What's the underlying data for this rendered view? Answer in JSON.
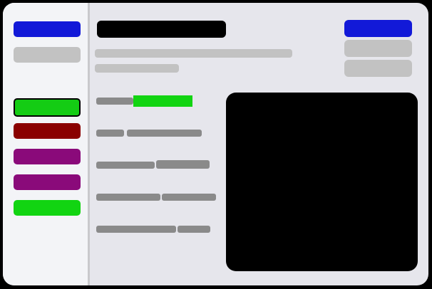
{
  "colors": {
    "primary": "#1219d8",
    "active": "#14cc14",
    "danger": "#8a0000",
    "purple": "#8a0a7a",
    "success": "#12d412",
    "muted": "#c2c2c2",
    "title_bar": "#000000",
    "preview": "#000000"
  },
  "sidebar": {
    "items": [
      {
        "label": ""
      },
      {
        "label": ""
      },
      {
        "label": ""
      },
      {
        "label": ""
      },
      {
        "label": ""
      },
      {
        "label": ""
      },
      {
        "label": ""
      }
    ]
  },
  "header": {
    "title": "",
    "subtitle": "",
    "meta": ""
  },
  "actions": {
    "primary_label": "",
    "secondary_label": "",
    "tertiary_label": ""
  },
  "details": {
    "rows": [
      {
        "label": "",
        "value": ""
      },
      {
        "label": "",
        "value": ""
      },
      {
        "label": "",
        "value": ""
      },
      {
        "label": "",
        "value": ""
      },
      {
        "label": "",
        "value": ""
      }
    ]
  }
}
